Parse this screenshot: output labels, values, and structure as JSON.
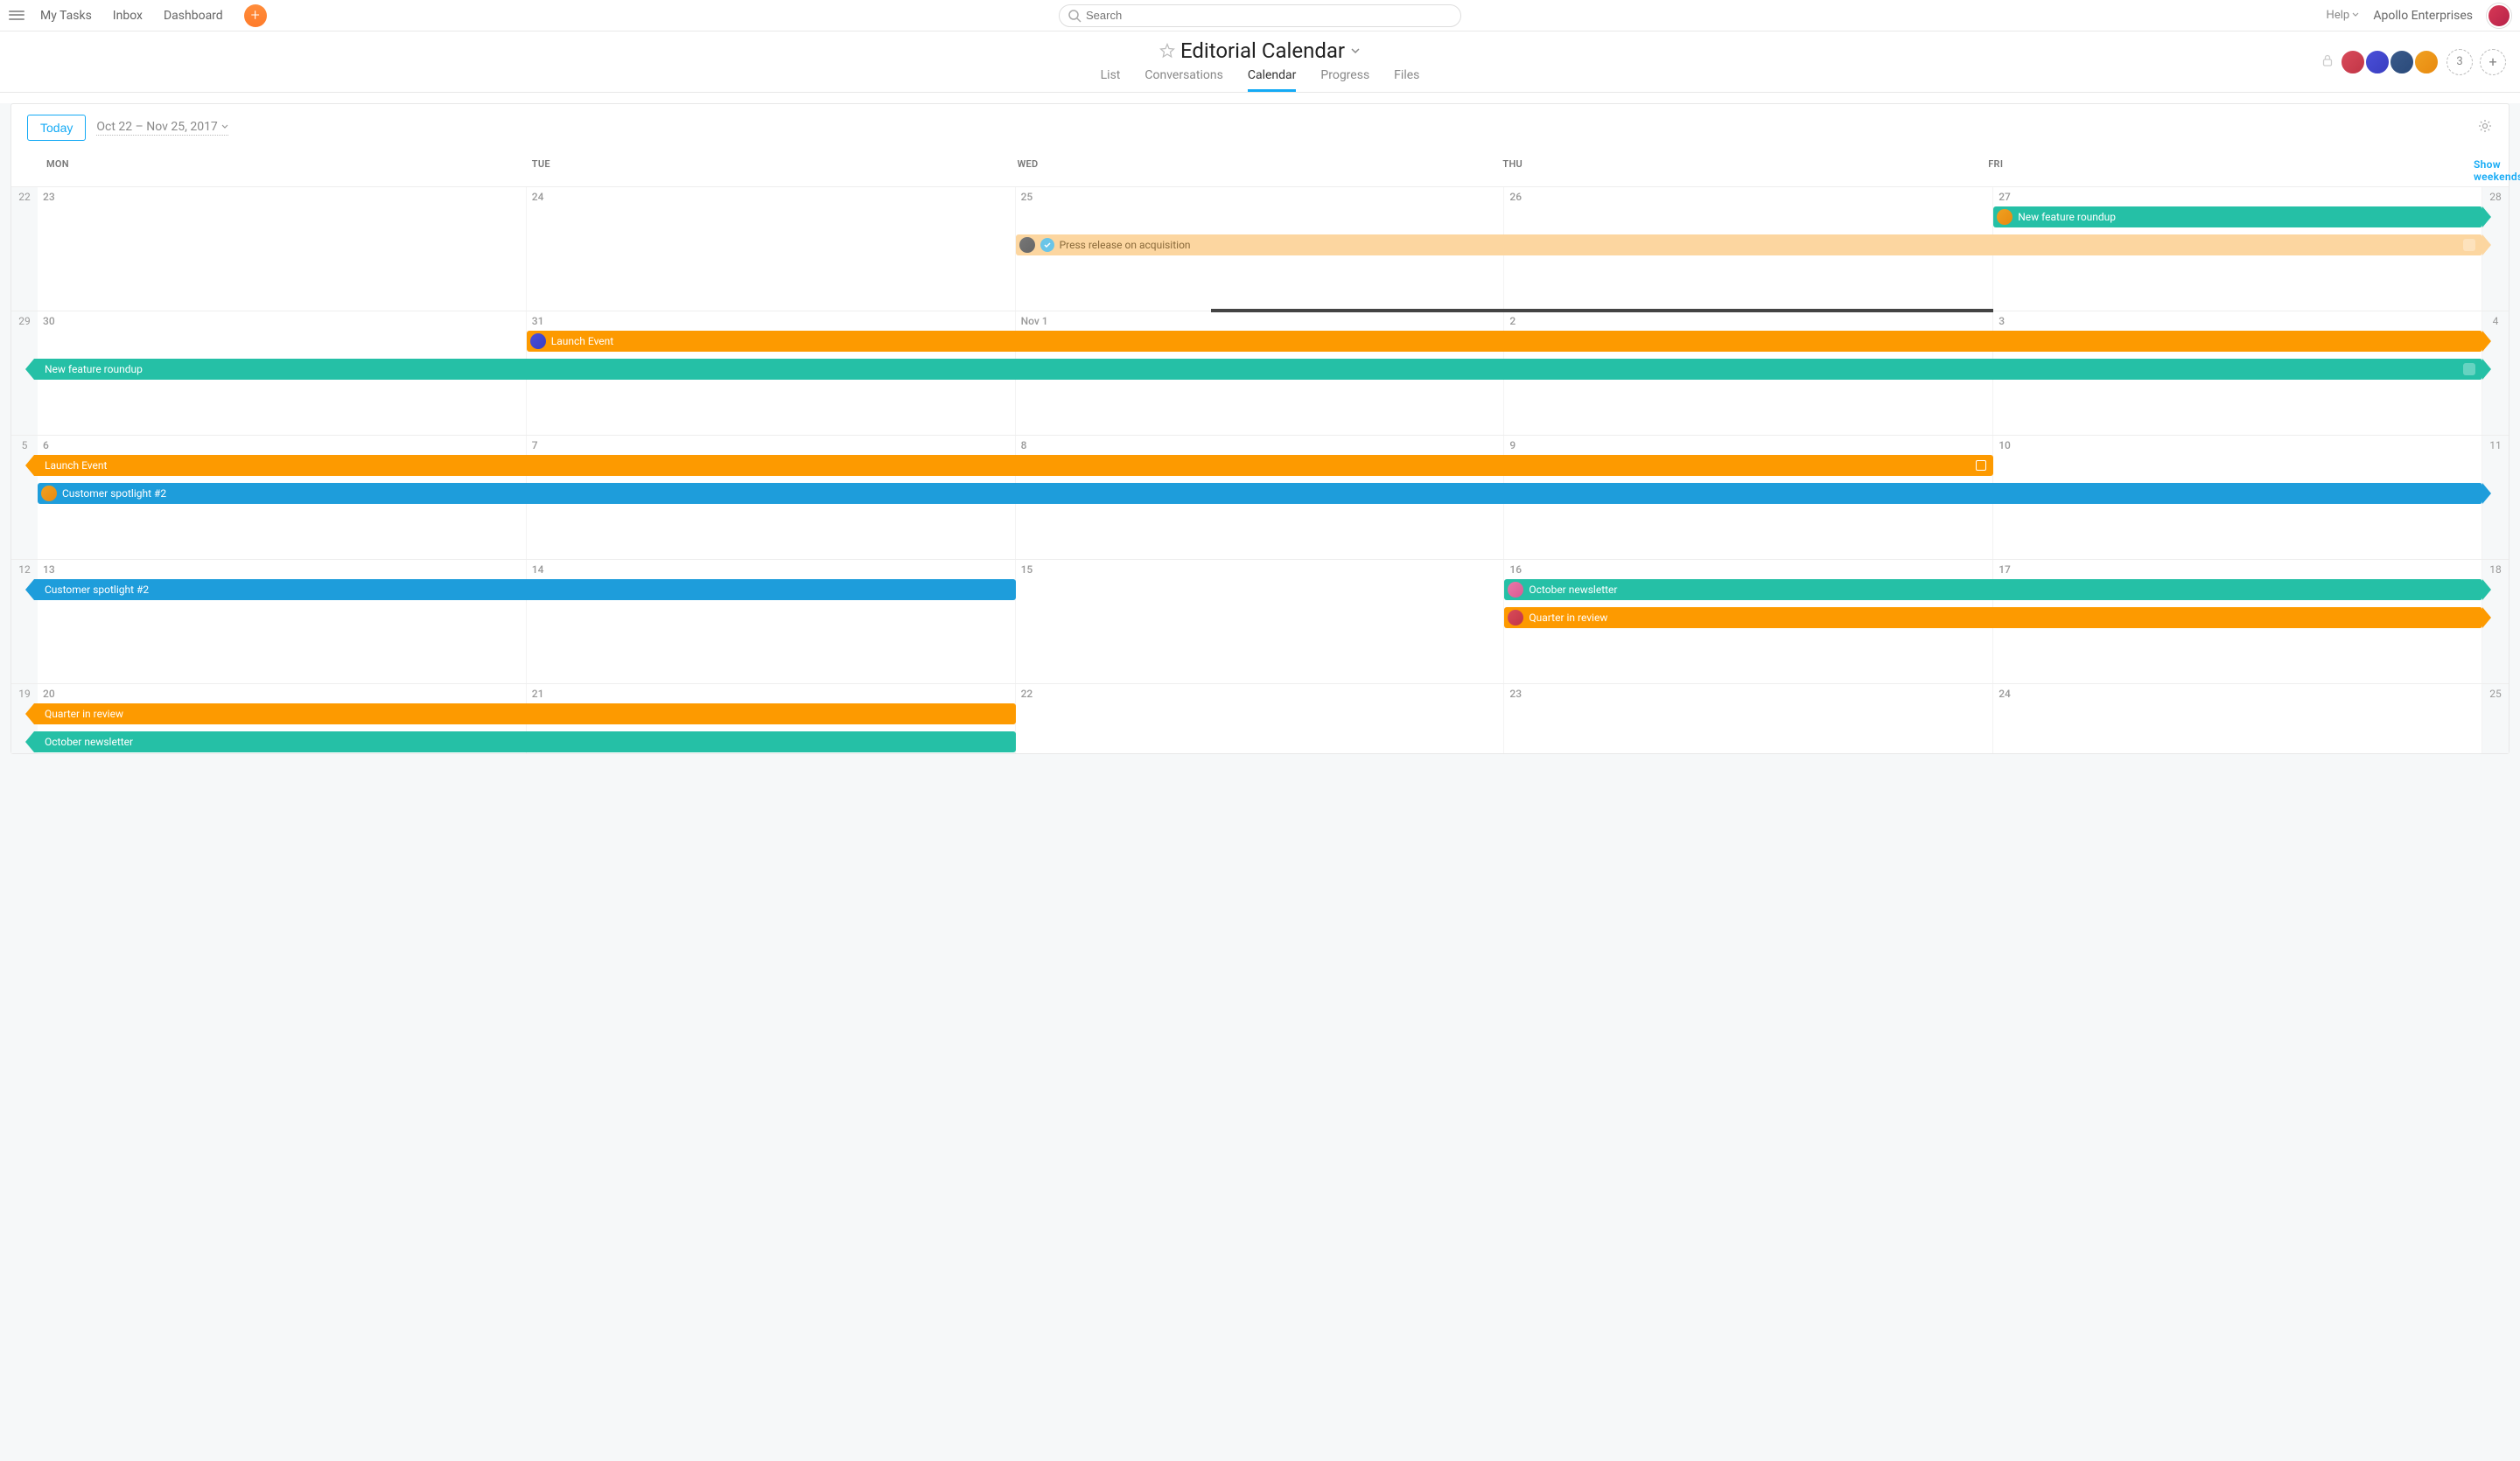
{
  "topnav": {
    "my_tasks": "My Tasks",
    "inbox": "Inbox",
    "dashboard": "Dashboard"
  },
  "search": {
    "placeholder": "Search"
  },
  "topright": {
    "help": "Help",
    "org": "Apollo Enterprises",
    "more_count": "3"
  },
  "project": {
    "title": "Editorial Calendar"
  },
  "tabs": {
    "list": "List",
    "conversations": "Conversations",
    "calendar": "Calendar",
    "progress": "Progress",
    "files": "Files"
  },
  "toolbar": {
    "today": "Today",
    "range": "Oct 22 – Nov 25, 2017"
  },
  "day_headers": {
    "mon": "MON",
    "tue": "TUE",
    "wed": "WED",
    "thu": "THU",
    "fri": "FRI",
    "show_weekends": "Show weekends"
  },
  "weeks": [
    {
      "wl": "22",
      "days": [
        "23",
        "24",
        "25",
        "26",
        "27"
      ],
      "wr": "28"
    },
    {
      "wl": "29",
      "days": [
        "30",
        "31",
        "Nov 1",
        "2",
        "3"
      ],
      "wr": "4"
    },
    {
      "wl": "5",
      "days": [
        "6",
        "7",
        "8",
        "9",
        "10"
      ],
      "wr": "11"
    },
    {
      "wl": "12",
      "days": [
        "13",
        "14",
        "15",
        "16",
        "17"
      ],
      "wr": "18"
    },
    {
      "wl": "19",
      "days": [
        "20",
        "21",
        "22",
        "23",
        "24"
      ],
      "wr": "25"
    }
  ],
  "tasks": {
    "w0": {
      "feature": "New feature roundup",
      "press": "Press release on acquisition"
    },
    "w1": {
      "launch": "Launch Event",
      "feature": "New feature roundup"
    },
    "w2": {
      "launch": "Launch Event",
      "spotlight": "Customer spotlight #2"
    },
    "w3": {
      "spotlight": "Customer spotlight #2",
      "newsletter": "October newsletter",
      "quarter": "Quarter in review"
    },
    "w4": {
      "quarter": "Quarter in review",
      "newsletter": "October newsletter"
    }
  }
}
